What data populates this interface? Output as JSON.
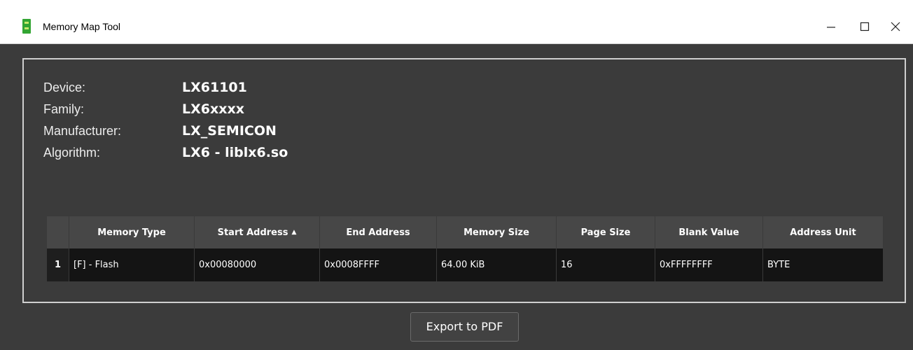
{
  "window": {
    "title": "Memory Map Tool",
    "controls": {
      "minimize": "—",
      "maximize": "☐",
      "close": "✕"
    }
  },
  "info": [
    {
      "label": "Device:",
      "value": "LX61101"
    },
    {
      "label": "Family:",
      "value": "LX6xxxx"
    },
    {
      "label": "Manufacturer:",
      "value": "LX_SEMICON"
    },
    {
      "label": "Algorithm:",
      "value": "LX6 - liblx6.so"
    }
  ],
  "table": {
    "headers": [
      "Memory Type",
      "Start Address",
      "End Address",
      "Memory Size",
      "Page Size",
      "Blank Value",
      "Address Unit"
    ],
    "sorted_column": "Start Address",
    "sort_direction": "ascending",
    "rows": [
      {
        "num": "1",
        "cells": [
          "[F] - Flash",
          "0x00080000",
          "0x0008FFFF",
          "64.00 KiB",
          "16",
          "0xFFFFFFFF",
          "BYTE"
        ]
      }
    ]
  },
  "actions": {
    "export_label": "Export to PDF"
  },
  "colors": {
    "background": "#3b3b3b",
    "table_header": "#474747",
    "table_row": "#141414",
    "app_icon": "#33a533"
  }
}
